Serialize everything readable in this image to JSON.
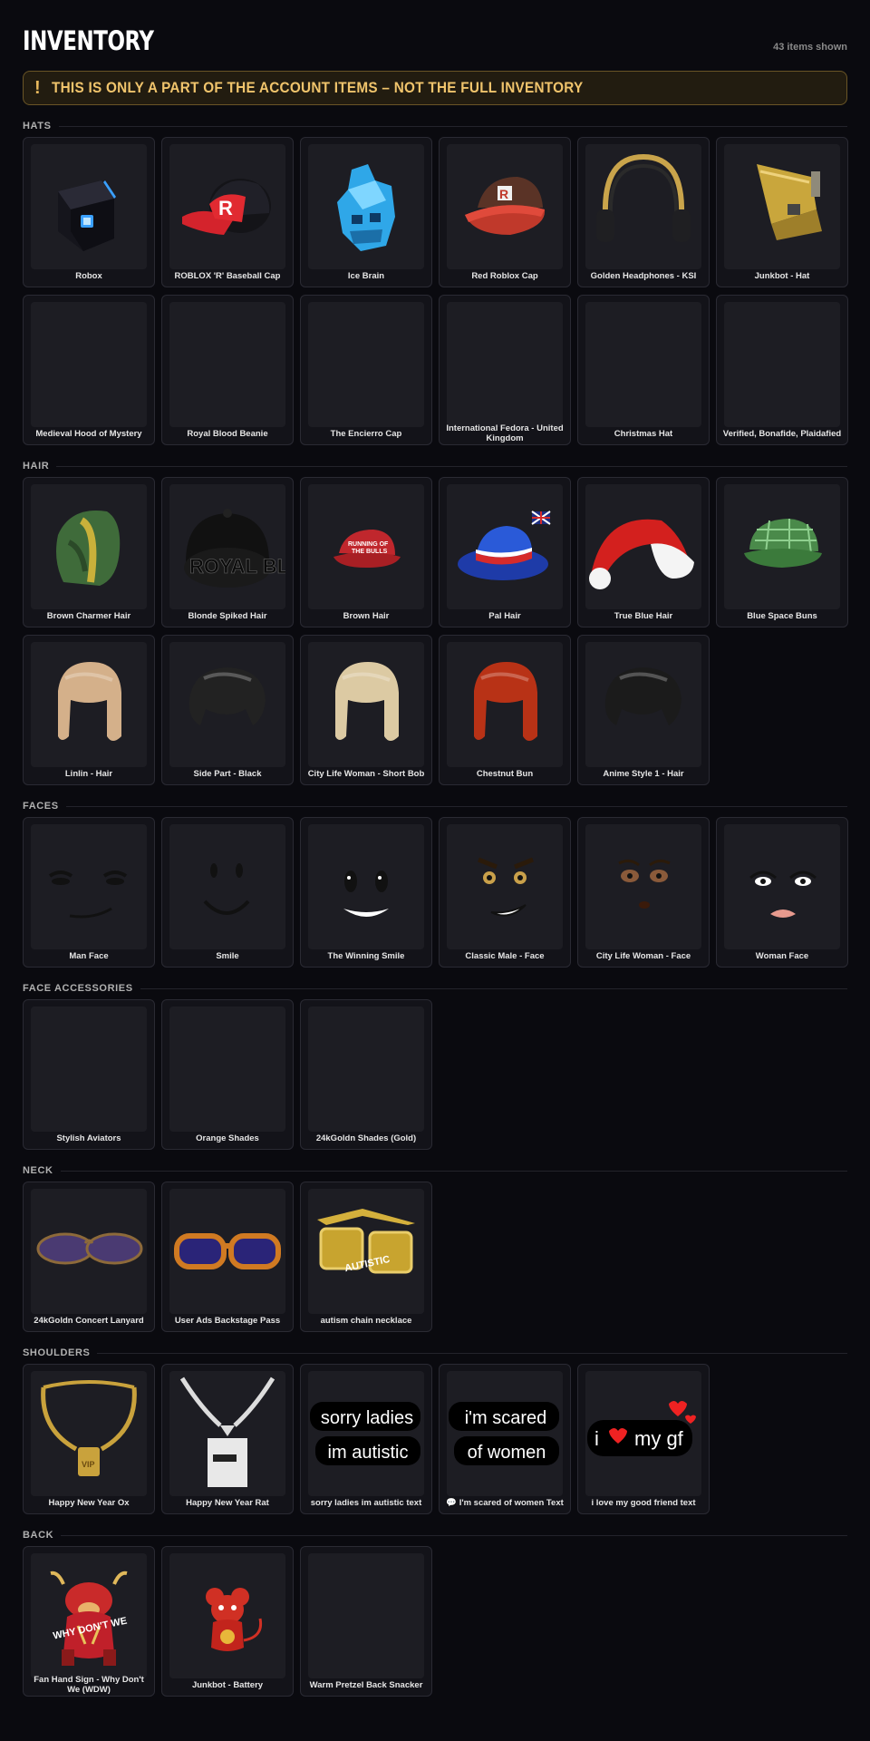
{
  "header": {
    "title": "INVENTORY",
    "count": "43 items shown"
  },
  "banner": {
    "mark": "!",
    "text": "THIS IS ONLY A PART OF THE ACCOUNT ITEMS – NOT THE FULL INVENTORY"
  },
  "sections": [
    {
      "title": "HATS",
      "items": [
        {
          "name": "Robox",
          "icon": "robox-cube-icon"
        },
        {
          "name": "ROBLOX 'R' Baseball Cap",
          "icon": "baseball-cap-icon"
        },
        {
          "name": "Ice Brain",
          "icon": "ice-brain-icon"
        },
        {
          "name": "Red Roblox Cap",
          "icon": "red-cap-icon"
        },
        {
          "name": "Golden Headphones - KSI",
          "icon": "headphones-icon"
        },
        {
          "name": "Junkbot - Hat",
          "icon": "junkbot-hat-icon"
        },
        {
          "name": "Medieval Hood of Mystery",
          "icon": "hood-icon"
        },
        {
          "name": "Royal Blood Beanie",
          "icon": "beanie-icon"
        },
        {
          "name": "The Encierro Cap",
          "icon": "encierro-cap-icon"
        },
        {
          "name": "International Fedora - United Kingdom",
          "icon": "fedora-icon"
        },
        {
          "name": "Christmas Hat",
          "icon": "santa-hat-icon"
        },
        {
          "name": "Verified, Bonafide, Plaidafied",
          "icon": "plaid-cap-icon"
        }
      ]
    },
    {
      "title": "HAIR",
      "items": [
        {
          "name": "Brown Charmer Hair",
          "icon": "hair-icon"
        },
        {
          "name": "Blonde Spiked Hair",
          "icon": "hair-icon"
        },
        {
          "name": "Brown Hair",
          "icon": "hair-icon"
        },
        {
          "name": "Pal Hair",
          "icon": "hair-icon"
        },
        {
          "name": "True Blue Hair",
          "icon": "hair-icon"
        },
        {
          "name": "Blue Space Buns",
          "icon": "hair-icon"
        },
        {
          "name": "Linlin - Hair",
          "icon": "hair-icon"
        },
        {
          "name": "Side Part - Black",
          "icon": "hair-icon"
        },
        {
          "name": "City Life Woman - Short Bob",
          "icon": "hair-icon"
        },
        {
          "name": "Chestnut Bun",
          "icon": "hair-icon"
        },
        {
          "name": "Anime Style 1 - Hair",
          "icon": "hair-icon"
        }
      ]
    },
    {
      "title": "FACES",
      "items": [
        {
          "name": "Man Face",
          "icon": "face-icon"
        },
        {
          "name": "Smile",
          "icon": "face-icon"
        },
        {
          "name": "The Winning Smile",
          "icon": "face-icon"
        },
        {
          "name": "Classic Male - Face",
          "icon": "face-icon"
        },
        {
          "name": "City Life Woman - Face",
          "icon": "face-icon"
        },
        {
          "name": "Woman Face",
          "icon": "face-icon"
        }
      ]
    },
    {
      "title": "FACE ACCESSORIES",
      "items": [
        {
          "name": "Stylish Aviators",
          "icon": "sunglasses-icon"
        },
        {
          "name": "Orange Shades",
          "icon": "sunglasses-icon"
        },
        {
          "name": "24kGoldn Shades (Gold)",
          "icon": "sunglasses-icon"
        }
      ]
    },
    {
      "title": "NECK",
      "items": [
        {
          "name": "24kGoldn Concert Lanyard",
          "icon": "gold-chain-icon"
        },
        {
          "name": "User Ads Backstage Pass",
          "icon": "lanyard-icon"
        },
        {
          "name": "autism chain necklace",
          "icon": "chain-text-icon",
          "overlay": "AUTISTIC"
        }
      ]
    },
    {
      "title": "SHOULDERS",
      "items": [
        {
          "name": "Happy New Year Ox",
          "icon": "ox-icon"
        },
        {
          "name": "Happy New Year Rat",
          "icon": "rat-icon"
        },
        {
          "name": "sorry ladies im autistic text",
          "icon": "text-bubble-icon",
          "lines": [
            "sorry ladies",
            "im autistic"
          ]
        },
        {
          "name": "💬 I'm scared of women Text",
          "icon": "text-bubble-icon",
          "lines": [
            "i'm scared",
            "of women"
          ]
        },
        {
          "name": "i love my good friend text",
          "icon": "text-bubble-icon",
          "lines": [
            "i",
            "my gf"
          ]
        }
      ]
    },
    {
      "title": "BACK",
      "items": [
        {
          "name": "Fan Hand Sign - Why Don't We (WDW)",
          "icon": "foam-finger-icon",
          "overlay": "WHY DON'T WE"
        },
        {
          "name": "Junkbot - Battery",
          "icon": "battery-icon"
        },
        {
          "name": "Warm Pretzel Back Snacker",
          "icon": "pretzel-icon"
        }
      ]
    }
  ]
}
